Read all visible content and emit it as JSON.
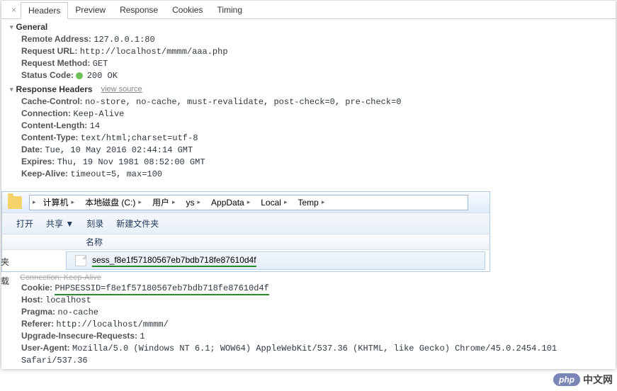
{
  "tabs": {
    "close": "×",
    "headers": "Headers",
    "preview": "Preview",
    "response": "Response",
    "cookies": "Cookies",
    "timing": "Timing"
  },
  "sections": {
    "general": "General",
    "response_headers": "Response Headers",
    "view_source": "view source"
  },
  "general": {
    "remote_address_k": "Remote Address:",
    "remote_address_v": "127.0.0.1:80",
    "request_url_k": "Request URL:",
    "request_url_v": "http://localhost/mmmm/aaa.php",
    "request_method_k": "Request Method:",
    "request_method_v": "GET",
    "status_code_k": "Status Code:",
    "status_code_v": "200 OK"
  },
  "resp": {
    "cache_control_k": "Cache-Control:",
    "cache_control_v": "no-store, no-cache, must-revalidate, post-check=0, pre-check=0",
    "connection_k": "Connection:",
    "connection_v": "Keep-Alive",
    "content_length_k": "Content-Length:",
    "content_length_v": "14",
    "content_type_k": "Content-Type:",
    "content_type_v": "text/html;charset=utf-8",
    "date_k": "Date:",
    "date_v": "Tue, 10 May 2016 02:44:14 GMT",
    "expires_k": "Expires:",
    "expires_v": "Thu, 19 Nov 1981 08:52:00 GMT",
    "keep_alive_k": "Keep-Alive:",
    "keep_alive_v": "timeout=5, max=100"
  },
  "explorer": {
    "path": [
      "计算机",
      "本地磁盘 (C:)",
      "用户",
      "ys",
      "AppData",
      "Local",
      "Temp"
    ],
    "toolbar": {
      "open": "打开",
      "share": "共享 ▼",
      "burn": "刻录",
      "newfolder": "新建文件夹"
    },
    "side1": "夹",
    "side2": "载",
    "col_name": "名称",
    "file": "sess_f8e1f57180567eb7bdb718fe87610d4f"
  },
  "req": {
    "conn_strike": "Connection: Keep-Alive",
    "cookie_k": "Cookie:",
    "cookie_v": "PHPSESSID=f8e1f57180567eb7bdb718fe87610d4f",
    "host_k": "Host:",
    "host_v": "localhost",
    "pragma_k": "Pragma:",
    "pragma_v": "no-cache",
    "referer_k": "Referer:",
    "referer_v": "http://localhost/mmmm/",
    "uir_k": "Upgrade-Insecure-Requests:",
    "uir_v": "1",
    "ua_k": "User-Agent:",
    "ua_v": "Mozilla/5.0 (Windows NT 6.1; WOW64) AppleWebKit/537.36 (KHTML, like Gecko) Chrome/45.0.2454.101 Safari/537.36"
  },
  "watermark": {
    "php": "php",
    "text": "中文网"
  }
}
